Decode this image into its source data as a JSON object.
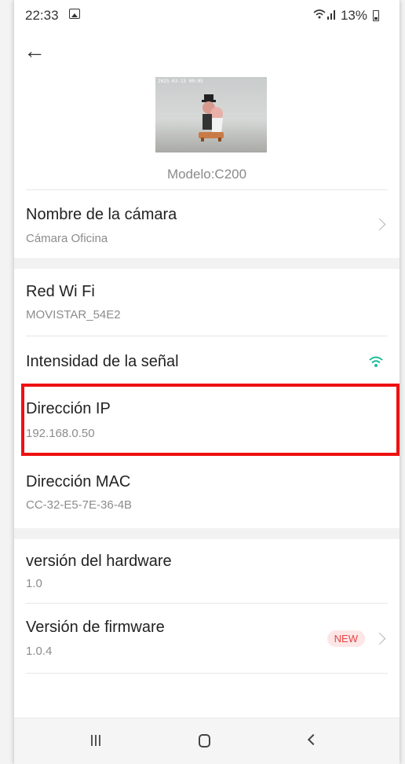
{
  "status_bar": {
    "time": "22:33",
    "signal_text": "℧.ıl",
    "battery": "13%"
  },
  "header": {
    "back_label": "←"
  },
  "camera": {
    "thumbnail_timestamp": "2025-03-15 00:05",
    "model_label": "Modelo:C200"
  },
  "rows": {
    "camera_name": {
      "title": "Nombre de la cámara",
      "value": "Cámara Oficina"
    },
    "wifi_network": {
      "title": "Red Wi Fi",
      "value": "MOVISTAR_54E2"
    },
    "signal_strength": {
      "title": "Intensidad de la señal"
    },
    "ip_address": {
      "title": "Dirección IP",
      "value": "192.168.0.50"
    },
    "mac_address": {
      "title": "Dirección MAC",
      "value": "CC-32-E5-7E-36-4B"
    },
    "hardware_version": {
      "title": "versión del hardware",
      "value": "1.0"
    },
    "firmware_version": {
      "title": "Versión de firmware",
      "value": "1.0.4",
      "badge": "NEW"
    }
  },
  "colors": {
    "highlight_border": "#ee1111",
    "wifi_icon": "#1abc9c",
    "new_badge": "#e64343"
  }
}
